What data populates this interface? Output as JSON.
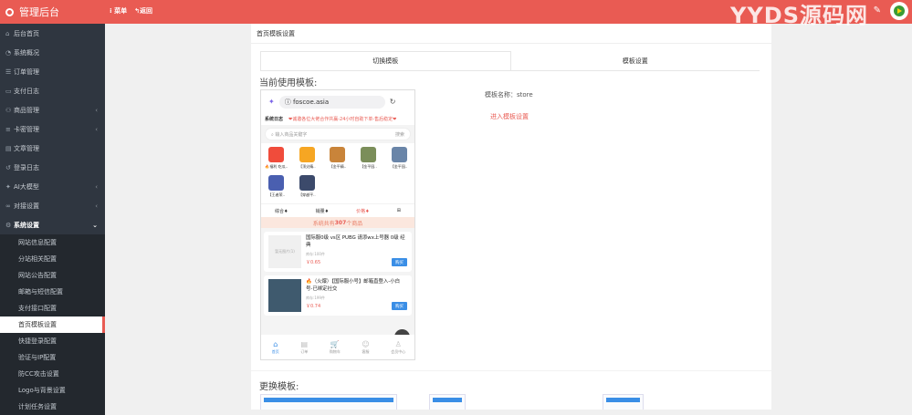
{
  "header": {
    "app_title": "管理后台",
    "nav": [
      "菜单",
      "返回"
    ],
    "watermark": "YYDS源码网",
    "tool_glyph": "✎"
  },
  "sidebar": {
    "items": [
      {
        "label": "后台首页",
        "icon": "home-icon",
        "glyph": "⌂"
      },
      {
        "label": "系统概况",
        "icon": "dashboard-icon",
        "glyph": "◔"
      },
      {
        "label": "订单管理",
        "icon": "list-icon",
        "glyph": "☰"
      },
      {
        "label": "支付日志",
        "icon": "card-icon",
        "glyph": "▭"
      },
      {
        "label": "商品管理",
        "icon": "cart-icon",
        "glyph": "⚇",
        "arrow": "‹"
      },
      {
        "label": "卡密管理",
        "icon": "lines-icon",
        "glyph": "≡",
        "arrow": "‹"
      },
      {
        "label": "文章管理",
        "icon": "doc-icon",
        "glyph": "▤"
      },
      {
        "label": "登录日志",
        "icon": "history-icon",
        "glyph": "↺"
      },
      {
        "label": "AI大模型",
        "icon": "ai-icon",
        "glyph": "✦",
        "arrow": "‹"
      },
      {
        "label": "对接设置",
        "icon": "link-icon",
        "glyph": "∞",
        "arrow": "‹"
      },
      {
        "label": "系统设置",
        "icon": "gear-icon",
        "glyph": "⚙",
        "arrow": "⌄",
        "active": true
      }
    ],
    "subitems": [
      {
        "label": "网站信息配置"
      },
      {
        "label": "分站相关配置"
      },
      {
        "label": "网站公告配置"
      },
      {
        "label": "邮箱与短信配置"
      },
      {
        "label": "支付接口配置"
      },
      {
        "label": "首页模板设置",
        "selected": true
      },
      {
        "label": "快捷登录配置"
      },
      {
        "label": "验证与IP配置"
      },
      {
        "label": "防CC攻击设置"
      },
      {
        "label": "Logo与背景设置"
      },
      {
        "label": "计划任务设置"
      }
    ]
  },
  "main": {
    "breadcrumb": "首页模板设置",
    "tabs": [
      "切换模板",
      "模板设置"
    ],
    "current_template_title": "当前使用模板:",
    "template_name": "模板名称：store",
    "enter_settings_link": "进入模板设置",
    "replace_title": "更换模板:"
  },
  "preview": {
    "url": "foscoe.asia",
    "notice_label": "系统日志",
    "notice_text": "❤诚邀各位大佬合作共赢-24小时自助下单-售后稳定❤",
    "search_placeholder": "输入商品关键字",
    "search_button": "搜索",
    "categories": [
      {
        "label": "🔥福利 吃瓜..",
        "color": "#f04c3b"
      },
      {
        "label": "【顶尖精..",
        "color": "#f6a623"
      },
      {
        "label": "【金平精..",
        "color": "#c9843a"
      },
      {
        "label": "【金平园..",
        "color": "#7b8e5a"
      },
      {
        "label": "【金平园..",
        "color": "#6a85a8"
      },
      {
        "label": "【王者荣..",
        "color": "#4a5fb0"
      },
      {
        "label": "【穿越平..",
        "color": "#3c4a6b"
      }
    ],
    "sort": [
      "综合",
      "销量",
      "价格"
    ],
    "count_prefix": "系统共有",
    "count_value": "307",
    "count_suffix": "个商品",
    "products": [
      {
        "image_text": "暂无图片(1)",
        "title": "国际服0级 vs区 PUBG 请添wx上号器 0级 经典",
        "stock": "库存:100件",
        "price": "￥0.65",
        "button": "购买"
      },
      {
        "image_text": "",
        "title": "🔥（火爆）【国际服小号】邮箱直登入-小白号-已绑定社交",
        "stock": "库存:199件",
        "price": "￥0.74",
        "button": "购买"
      }
    ],
    "bottom_nav": [
      "首页",
      "订单",
      "购物车",
      "客服",
      "会员中心"
    ],
    "bottom_glyphs": [
      "⌂",
      "▤",
      "🛒",
      "☺",
      "♙"
    ]
  }
}
